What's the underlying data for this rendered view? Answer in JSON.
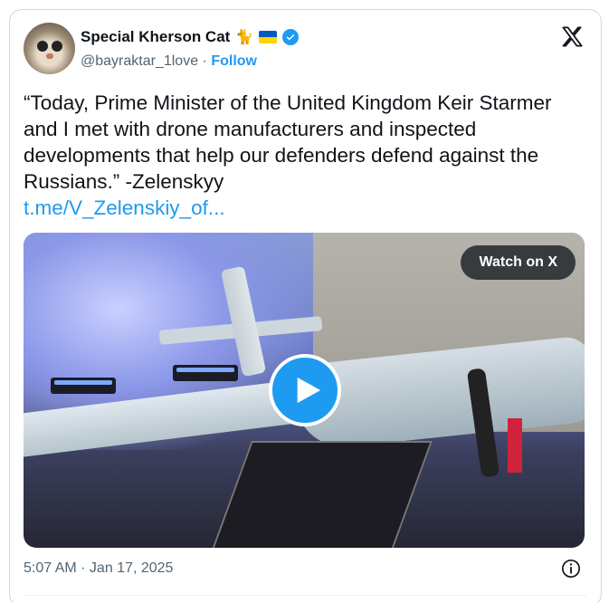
{
  "author": {
    "name": "Special Kherson Cat",
    "emoji": "🐈",
    "handle": "@bayraktar_1love",
    "separator": "·",
    "follow_label": "Follow",
    "verified_color": "#1d9bf0"
  },
  "tweet": {
    "text": "“Today, Prime Minister of the United Kingdom Keir Starmer and I met with drone manufacturers and inspected developments that help our defenders defend against the Russians.” -Zelenskyy",
    "link": "t.me/V_Zelenskiy_of..."
  },
  "media": {
    "watch_label": "Watch on X",
    "play_icon": "play-icon"
  },
  "footer": {
    "timestamp": "5:07 AM · Jan 17, 2025",
    "info_icon": "info-icon"
  },
  "colors": {
    "accent": "#1d9bf0",
    "muted_text": "#536471",
    "text": "#0f1419",
    "border": "#cfd9de"
  }
}
